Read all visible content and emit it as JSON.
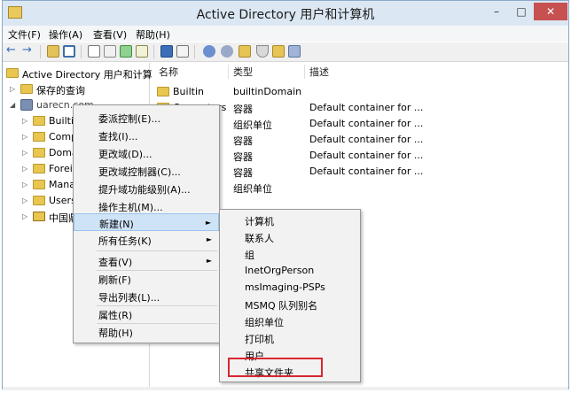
{
  "window": {
    "title": "Active Directory 用户和计算机",
    "min_glyph": "–",
    "max_glyph": "□",
    "close_glyph": "✕"
  },
  "menubar": [
    "文件(F)",
    "操作(A)",
    "查看(V)",
    "帮助(H)"
  ],
  "toolbar": {
    "back": "←",
    "forward": "→"
  },
  "tree": {
    "root": "Active Directory 用户和计算机",
    "saved_queries": "保存的查询",
    "domain": "uarecn.com",
    "children": [
      "Builtin",
      "Comp",
      "Doma",
      "Foreig",
      "Mana",
      "Users",
      "中国鼎"
    ]
  },
  "list": {
    "headers": [
      "名称",
      "类型",
      "描述"
    ],
    "rows": [
      {
        "name": "Builtin",
        "type": "builtinDomain",
        "desc": ""
      },
      {
        "name": "Computers",
        "type": "容器",
        "desc": "Default container for ..."
      },
      {
        "name": "",
        "type": "组织单位",
        "desc": "Default container for ..."
      },
      {
        "name": "",
        "type": "容器",
        "desc": "Default container for ..."
      },
      {
        "name": "",
        "type": "容器",
        "desc": "Default container for ..."
      },
      {
        "name": "",
        "type": "容器",
        "desc": "Default container for ..."
      },
      {
        "name": "",
        "type": "组织单位",
        "desc": ""
      }
    ]
  },
  "context_menu": {
    "items": [
      "委派控制(E)...",
      "查找(I)...",
      "更改域(D)...",
      "更改域控制器(C)...",
      "提升域功能级别(A)...",
      "操作主机(M)...",
      "新建(N)",
      "所有任务(K)",
      "查看(V)",
      "刷新(F)",
      "导出列表(L)...",
      "属性(R)",
      "帮助(H)"
    ],
    "arrow": "►"
  },
  "submenu": {
    "items": [
      "计算机",
      "联系人",
      "组",
      "InetOrgPerson",
      "msImaging-PSPs",
      "MSMQ 队列别名",
      "组织单位",
      "打印机",
      "用户",
      "共享文件夹"
    ]
  },
  "colors": {
    "highlight": "#cfe3f7",
    "annotation": "#d9262f",
    "folder": "#e8c64f"
  }
}
